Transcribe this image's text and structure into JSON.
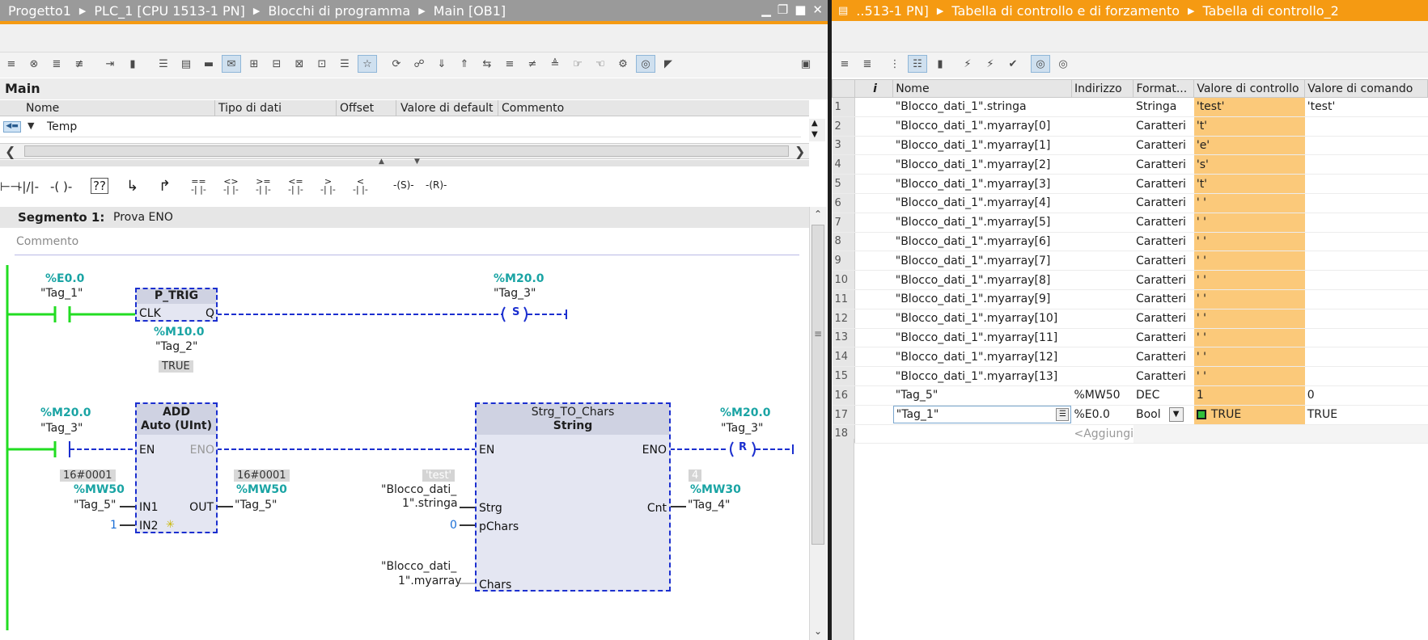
{
  "left_pane": {
    "breadcrumb": [
      "Progetto1",
      "PLC_1 [CPU 1513-1 PN]",
      "Blocchi di programma",
      "Main [OB1]"
    ],
    "block_name": "Main",
    "interface_columns": [
      "Nome",
      "Tipo di dati",
      "Offset",
      "Valore di default",
      "Commento"
    ],
    "interface_row": "Temp",
    "segment": {
      "title": "Segmento 1:",
      "label": "Prova ENO",
      "comment_placeholder": "Commento"
    },
    "rung1": {
      "contact_addr": "%E0.0",
      "contact_tag": "\"Tag_1\"",
      "ptrig_title": "P_TRIG",
      "ptrig_clk": "CLK",
      "ptrig_q": "Q",
      "ptrig_addr": "%M10.0",
      "ptrig_tag": "\"Tag_2\"",
      "ptrig_value": "TRUE",
      "coil_addr": "%M20.0",
      "coil_tag": "\"Tag_3\"",
      "coil_label": "S"
    },
    "rung2": {
      "contact_addr": "%M20.0",
      "contact_tag": "\"Tag_3\"",
      "add_title": "ADD",
      "add_type": "Auto (UInt)",
      "add_en": "EN",
      "add_eno": "ENO",
      "add_in1": "IN1",
      "add_in2": "IN2",
      "add_out": "OUT",
      "in1_value": "16#0001",
      "in1_addr": "%MW50",
      "in1_tag": "\"Tag_5\"",
      "in2_value": "1",
      "out_value": "16#0001",
      "out_addr": "%MW50",
      "out_tag": "\"Tag_5\"",
      "strg_title": "Strg_TO_Chars",
      "strg_type": "String",
      "strg_en": "EN",
      "strg_eno": "ENO",
      "strg_strg": "Strg",
      "strg_pchars": "pChars",
      "strg_chars": "Chars",
      "strg_cnt": "Cnt",
      "strg_value": "'test'",
      "strg_tag_a": "\"Blocco_dati_",
      "strg_tag_b": "1\".stringa",
      "pchars_value": "0",
      "chars_tag_a": "\"Blocco_dati_",
      "chars_tag_b": "1\".myarray",
      "cnt_value": "4",
      "cnt_addr": "%MW30",
      "cnt_tag": "\"Tag_4\"",
      "coil_addr": "%M20.0",
      "coil_tag": "\"Tag_3\"",
      "coil_label": "R"
    }
  },
  "right_pane": {
    "breadcrumb": [
      "..513-1 PN]",
      "Tabella di controllo e di forzamento",
      "Tabella di controllo_2"
    ],
    "columns": [
      "i",
      "Nome",
      "Indirizzo",
      "Format...",
      "Valore di controllo",
      "Valore di comando"
    ],
    "rows": [
      {
        "n": "1",
        "nome": "\"Blocco_dati_1\".stringa",
        "indirizzo": "",
        "formato": "Stringa",
        "controllo": "'test'",
        "comando": "'test'"
      },
      {
        "n": "2",
        "nome": "\"Blocco_dati_1\".myarray[0]",
        "indirizzo": "",
        "formato": "Caratteri",
        "controllo": "'t'",
        "comando": ""
      },
      {
        "n": "3",
        "nome": "\"Blocco_dati_1\".myarray[1]",
        "indirizzo": "",
        "formato": "Caratteri",
        "controllo": "'e'",
        "comando": ""
      },
      {
        "n": "4",
        "nome": "\"Blocco_dati_1\".myarray[2]",
        "indirizzo": "",
        "formato": "Caratteri",
        "controllo": "'s'",
        "comando": ""
      },
      {
        "n": "5",
        "nome": "\"Blocco_dati_1\".myarray[3]",
        "indirizzo": "",
        "formato": "Caratteri",
        "controllo": "'t'",
        "comando": ""
      },
      {
        "n": "6",
        "nome": "\"Blocco_dati_1\".myarray[4]",
        "indirizzo": "",
        "formato": "Caratteri",
        "controllo": "' '",
        "comando": ""
      },
      {
        "n": "7",
        "nome": "\"Blocco_dati_1\".myarray[5]",
        "indirizzo": "",
        "formato": "Caratteri",
        "controllo": "' '",
        "comando": ""
      },
      {
        "n": "8",
        "nome": "\"Blocco_dati_1\".myarray[6]",
        "indirizzo": "",
        "formato": "Caratteri",
        "controllo": "' '",
        "comando": ""
      },
      {
        "n": "9",
        "nome": "\"Blocco_dati_1\".myarray[7]",
        "indirizzo": "",
        "formato": "Caratteri",
        "controllo": "' '",
        "comando": ""
      },
      {
        "n": "10",
        "nome": "\"Blocco_dati_1\".myarray[8]",
        "indirizzo": "",
        "formato": "Caratteri",
        "controllo": "' '",
        "comando": ""
      },
      {
        "n": "11",
        "nome": "\"Blocco_dati_1\".myarray[9]",
        "indirizzo": "",
        "formato": "Caratteri",
        "controllo": "' '",
        "comando": ""
      },
      {
        "n": "12",
        "nome": "\"Blocco_dati_1\".myarray[10]",
        "indirizzo": "",
        "formato": "Caratteri",
        "controllo": "' '",
        "comando": ""
      },
      {
        "n": "13",
        "nome": "\"Blocco_dati_1\".myarray[11]",
        "indirizzo": "",
        "formato": "Caratteri",
        "controllo": "' '",
        "comando": ""
      },
      {
        "n": "14",
        "nome": "\"Blocco_dati_1\".myarray[12]",
        "indirizzo": "",
        "formato": "Caratteri",
        "controllo": "' '",
        "comando": ""
      },
      {
        "n": "15",
        "nome": "\"Blocco_dati_1\".myarray[13]",
        "indirizzo": "",
        "formato": "Caratteri",
        "controllo": "' '",
        "comando": ""
      },
      {
        "n": "16",
        "nome": "\"Tag_5\"",
        "indirizzo": "%MW50",
        "formato": "DEC",
        "controllo": "1",
        "comando": "0"
      },
      {
        "n": "17",
        "nome": "\"Tag_1\"",
        "indirizzo": "%E0.0",
        "formato": "Bool",
        "controllo": "TRUE",
        "comando": "TRUE"
      },
      {
        "n": "18",
        "nome": "",
        "indirizzo": "<Aggiungi",
        "formato": "",
        "controllo": "",
        "comando": ""
      }
    ]
  },
  "colors": {
    "accent_orange": "#f59a12",
    "ladder_blue": "#1b2fcf",
    "power_green": "#22dd22",
    "addr_teal": "#1aa4a4"
  }
}
